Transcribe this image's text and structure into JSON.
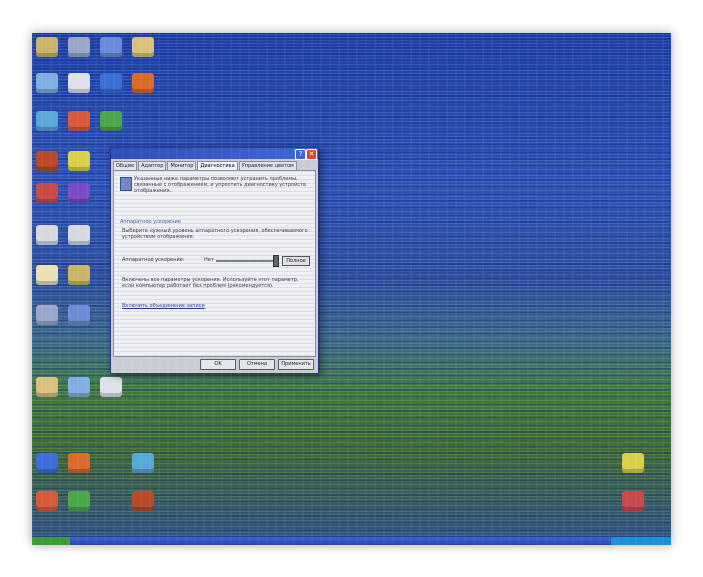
{
  "desktop": {
    "icons": [
      {
        "label": "",
        "color": "#c9b46a"
      },
      {
        "label": "",
        "color": "#9aa7c8"
      },
      {
        "label": "",
        "color": "#6b8bd6"
      },
      {
        "label": "",
        "color": "#d8c27a"
      },
      {
        "label": "",
        "color": "#7fb0e0"
      },
      {
        "label": "",
        "color": "#e0e0e8"
      },
      {
        "label": "",
        "color": "#3a6fd8"
      },
      {
        "label": "",
        "color": "#d86a2a"
      },
      {
        "label": "",
        "color": "#58a8d8"
      },
      {
        "label": "",
        "color": "#d85a3a"
      },
      {
        "label": "",
        "color": "#4aa84a"
      },
      {
        "label": "",
        "color": "#b84a2a"
      },
      {
        "label": "",
        "color": "#d8d04a"
      },
      {
        "label": "",
        "color": "#c84a4a"
      },
      {
        "label": "",
        "color": "#7a4ac8"
      },
      {
        "label": "",
        "color": "#d8d8e0"
      },
      {
        "label": "",
        "color": "#d8d8e0"
      },
      {
        "label": "",
        "color": "#e8e0b8"
      }
    ]
  },
  "window": {
    "title": "",
    "tabs": [
      {
        "label": "Общие"
      },
      {
        "label": "Адаптер"
      },
      {
        "label": "Монитор"
      },
      {
        "label": "Диагностика"
      },
      {
        "label": "Управление цветом"
      }
    ],
    "active_tab_index": 3,
    "intro_text": "Указанные ниже параметры позволяют устранить проблемы, связанные с отображением, и упростить диагностику устройств отображения.",
    "group_title": "Аппаратное ускорение",
    "group_text": "Выберите нужный уровень аппаратного ускорения, обеспечиваемого устройством отображения.",
    "slider": {
      "label": "Аппаратное ускорение:",
      "min_label": "Нет",
      "max_label": "Полное",
      "level": 1.0
    },
    "description": "Включены все параметры ускорения. Используйте этот параметр, если компьютер работает без проблем (рекомендуется).",
    "link_text": "Включить объединение записи",
    "buttons": {
      "ok": "OK",
      "cancel": "Отмена",
      "apply": "Применить"
    }
  },
  "taskbar": {
    "start_label": "",
    "tray_text": ""
  }
}
